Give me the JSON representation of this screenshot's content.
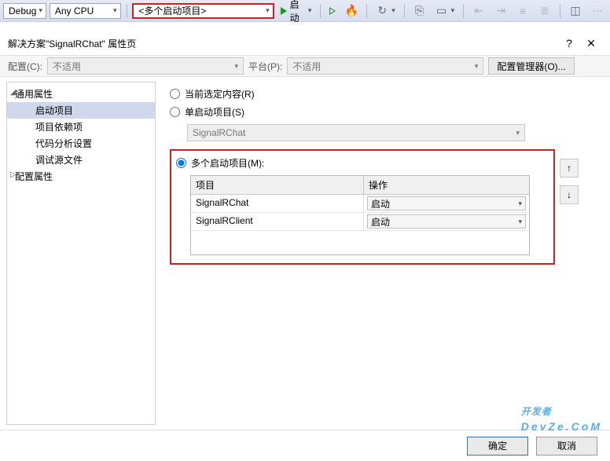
{
  "toolbar": {
    "debug": "Debug",
    "cpu": "Any CPU",
    "startup": "<多个启动项目>",
    "start_label": "启动"
  },
  "dialog": {
    "title": "解决方案\"SignalRChat\" 属性页",
    "help": "?",
    "close": "✕"
  },
  "config_row": {
    "config_label": "配置(C):",
    "config_value": "不适用",
    "platform_label": "平台(P):",
    "platform_value": "不适用",
    "manager_btn": "配置管理器(O)..."
  },
  "tree": {
    "common": "通用属性",
    "items": [
      "启动项目",
      "项目依赖项",
      "代码分析设置",
      "调试源文件"
    ],
    "config_props": "配置属性"
  },
  "content": {
    "radio_current": "当前选定内容(R)",
    "radio_single": "单启动项目(S)",
    "single_value": "SignalRChat",
    "radio_multi": "多个启动项目(M):",
    "grid": {
      "col_project": "项目",
      "col_action": "操作",
      "rows": [
        {
          "project": "SignalRChat",
          "action": "启动"
        },
        {
          "project": "SignalRClient",
          "action": "启动"
        }
      ]
    }
  },
  "footer": {
    "ok": "确定",
    "cancel": "取消"
  },
  "watermark": {
    "main": "开发者",
    "sub": "DevZe.CoM"
  }
}
